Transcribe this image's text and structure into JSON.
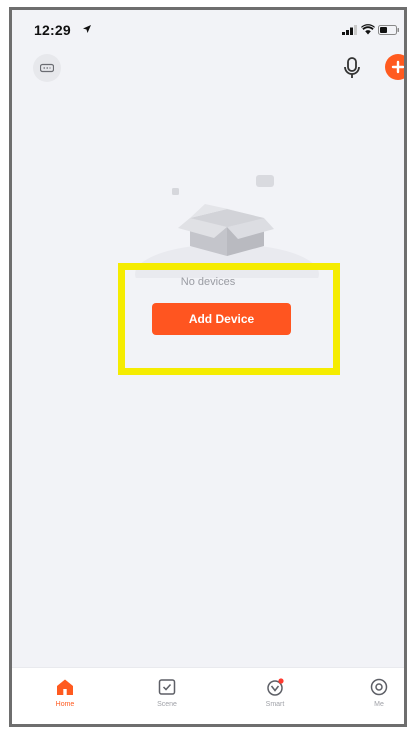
{
  "status_bar": {
    "time": "12:29"
  },
  "empty_state": {
    "message": "No devices",
    "button_label": "Add Device"
  },
  "tabs": [
    {
      "label": "Home",
      "active": true
    },
    {
      "label": "Scene",
      "active": false
    },
    {
      "label": "Smart",
      "active": false
    },
    {
      "label": "Me",
      "active": false
    }
  ],
  "colors": {
    "accent": "#ff5520",
    "background": "#f2f3f7",
    "highlight": "#f5ec00"
  },
  "icons": [
    "location-arrow-icon",
    "signal-icon",
    "wifi-icon",
    "battery-icon",
    "menu-icon",
    "microphone-icon",
    "plus-icon",
    "empty-box-icon",
    "home-icon",
    "scene-icon",
    "smart-icon",
    "me-icon"
  ]
}
